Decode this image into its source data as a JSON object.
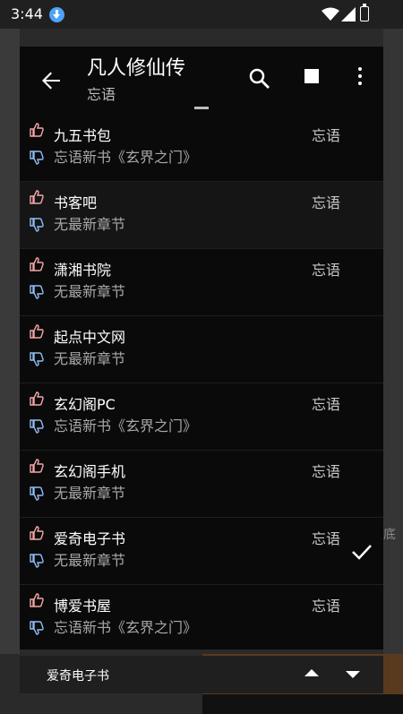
{
  "status": {
    "time": "3:44"
  },
  "header": {
    "title": "凡人修仙传",
    "subtitle": "忘语"
  },
  "sources": [
    {
      "name": "九五书包",
      "latest": "忘语新书《玄界之门》",
      "author": "忘语",
      "selected": false
    },
    {
      "name": "书客吧",
      "latest": "无最新章节",
      "author": "忘语",
      "selected": false
    },
    {
      "name": "潇湘书院",
      "latest": "无最新章节",
      "author": "忘语",
      "selected": false
    },
    {
      "name": "起点中文网",
      "latest": "无最新章节",
      "author": "",
      "selected": false
    },
    {
      "name": "玄幻阁PC",
      "latest": "忘语新书《玄界之门》",
      "author": "忘语",
      "selected": false
    },
    {
      "name": "玄幻阁手机",
      "latest": "无最新章节",
      "author": "忘语",
      "selected": false
    },
    {
      "name": "爱奇电子书",
      "latest": "无最新章节",
      "author": "忘语",
      "selected": true
    },
    {
      "name": "博爱书屋",
      "latest": "忘语新书《玄界之门》",
      "author": "忘语",
      "selected": false
    }
  ],
  "bottom": {
    "current_source": "爱奇电子书"
  },
  "icons": {
    "back": "arrow-back-icon",
    "search": "search-icon",
    "stop": "stop-icon",
    "more": "more-vert-icon",
    "like": "thumb-up-icon",
    "dislike": "thumb-down-icon",
    "check": "check-icon"
  },
  "colors": {
    "like": "#f4a6a6",
    "dislike": "#8fbcf2",
    "dialog_bg": "#0a0a0a"
  }
}
